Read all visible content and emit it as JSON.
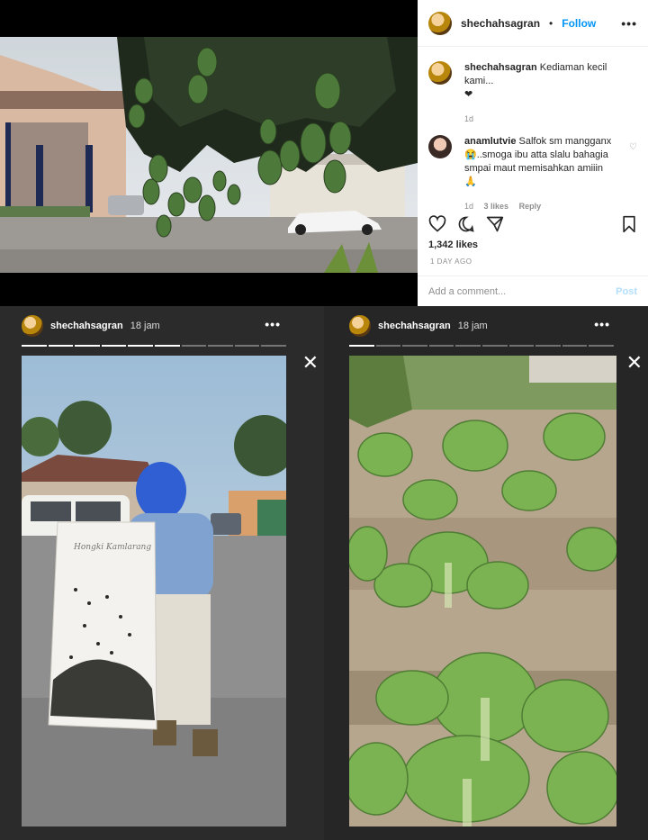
{
  "post": {
    "username": "shechahsagran",
    "separator": "•",
    "follow_label": "Follow",
    "more_label": "•••",
    "caption": {
      "username": "shechahsagran",
      "text": "Kediaman kecil kami...",
      "heart": "❤",
      "age": "1d"
    },
    "comment": {
      "username": "anamlutvie",
      "text": "Salfok sm mangganx 😭..smoga ibu atta slalu bahagia smpai maut memisahkan amiiin 🙏",
      "age": "1d",
      "likes": "3 likes",
      "reply_label": "Reply"
    },
    "likes_count": "1,342 likes",
    "time_ago": "1 DAY AGO",
    "add_comment_placeholder": "Add a comment...",
    "post_label": "Post"
  },
  "stories": [
    {
      "username": "shechahsagran",
      "time": "18 jam",
      "more_label": "•••",
      "close_label": "✕",
      "segments": 10,
      "current": 6
    },
    {
      "username": "shechahsagran",
      "time": "18 jam",
      "more_label": "•••",
      "close_label": "✕",
      "segments": 10,
      "current": 1
    }
  ],
  "colors": {
    "accent": "#0095f6",
    "story_bg": "#2b2b2b"
  }
}
